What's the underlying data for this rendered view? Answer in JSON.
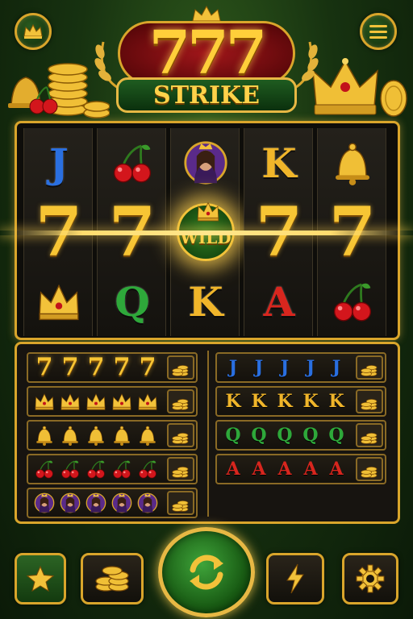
{
  "logo": {
    "number": "777",
    "name": "STRIKE"
  },
  "reels": [
    [
      {
        "type": "letter",
        "text": "J",
        "color": "#2a6fe0"
      },
      {
        "type": "seven",
        "text": "7"
      },
      {
        "type": "crown"
      }
    ],
    [
      {
        "type": "cherry"
      },
      {
        "type": "seven",
        "text": "7"
      },
      {
        "type": "letter",
        "text": "Q",
        "color": "#2ea83a"
      }
    ],
    [
      {
        "type": "queen"
      },
      {
        "type": "wild",
        "text": "WILD"
      },
      {
        "type": "letter",
        "text": "K",
        "color": "#f0b52a"
      }
    ],
    [
      {
        "type": "letter",
        "text": "K",
        "color": "#f0b52a"
      },
      {
        "type": "seven",
        "text": "7"
      },
      {
        "type": "letter",
        "text": "A",
        "color": "#d8261e"
      }
    ],
    [
      {
        "type": "bell"
      },
      {
        "type": "seven",
        "text": "7"
      },
      {
        "type": "cherry"
      }
    ]
  ],
  "paytable": {
    "left": [
      {
        "symbol": "seven",
        "text": "7"
      },
      {
        "symbol": "crown",
        "text": ""
      },
      {
        "symbol": "bell",
        "text": ""
      },
      {
        "symbol": "cherry",
        "text": ""
      },
      {
        "symbol": "queen",
        "text": ""
      }
    ],
    "right": [
      {
        "symbol": "letter",
        "text": "J",
        "color": "#2a6fe0"
      },
      {
        "symbol": "letter",
        "text": "K",
        "color": "#f0b52a"
      },
      {
        "symbol": "letter",
        "text": "Q",
        "color": "#2ea83a"
      },
      {
        "symbol": "letter",
        "text": "A",
        "color": "#d8261e"
      }
    ],
    "symbols_per_row": 5
  },
  "buttons": {
    "top_left": "crown-icon",
    "top_right": "menu-icon",
    "bottom": [
      "star-icon",
      "coins-icon",
      "spin-icon",
      "lightning-icon",
      "gear-icon"
    ]
  },
  "colors": {
    "gold": "#d9a52b",
    "green": "#1f5c20",
    "red": "#a0161a"
  }
}
